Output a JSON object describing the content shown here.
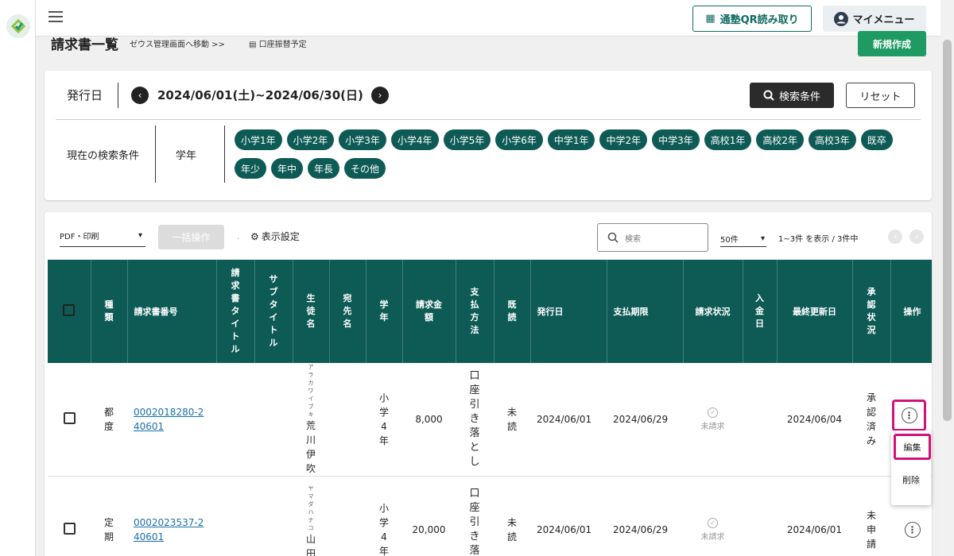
{
  "header": {
    "qr_label": "通塾QR読み取り",
    "mymenu_label": "マイメニュー"
  },
  "page": {
    "title": "請求書一覧",
    "zeus_link": "ゼウス管理画面へ移動 >>",
    "schedule_link": "口座振替予定",
    "new_button": "新規作成"
  },
  "filter": {
    "date_label": "発行日",
    "date_range": "2024/06/01(土)~2024/06/30(日)",
    "search_button": "検索条件",
    "reset_button": "リセット",
    "current_label": "現在の検索条件",
    "grade_label": "学年",
    "chips": [
      "小学1年",
      "小学2年",
      "小学3年",
      "小学4年",
      "小学5年",
      "小学6年",
      "中学1年",
      "中学2年",
      "中学3年",
      "高校1年",
      "高校2年",
      "高校3年",
      "既卒",
      "年少",
      "年中",
      "年長",
      "その他"
    ]
  },
  "toolbar": {
    "pdf_select": "PDF・印刷",
    "bulk_button": "一括操作",
    "display_settings": "表示設定",
    "search_placeholder": "検索",
    "page_size": "50件",
    "range_text": "1~3件 を表示 / 3件中"
  },
  "table": {
    "headers": {
      "type": "種類",
      "number": "請求書番号",
      "title": "請求書タイトル",
      "subtitle": "サブタイトル",
      "student": "生徒名",
      "addressee": "宛先名",
      "grade": "学年",
      "amount": "請求金額",
      "method": "支払方法",
      "read": "既読",
      "issued": "発行日",
      "due": "支払期限",
      "status": "請求状況",
      "paid": "入金日",
      "updated": "最終更新日",
      "approval": "承認状況",
      "ops": "操作"
    },
    "rows": [
      {
        "type": "都度",
        "number": "0002018280-240601",
        "student_kana": "アラカワイブキ",
        "student": "荒川伊吹",
        "grade": "小学4年",
        "amount": "8,000",
        "method": "口座引き落とし",
        "read": "未読",
        "issued": "2024/06/01",
        "due": "2024/06/29",
        "status": "未請求",
        "updated": "2024/06/04",
        "approval": "承認済み"
      },
      {
        "type": "定期",
        "number": "0002023537-240601",
        "student_kana": "ヤマダハナコ",
        "student": "山田花",
        "grade": "小学4年",
        "amount": "20,000",
        "method": "口座引き落と",
        "read": "未読",
        "issued": "2024/06/01",
        "due": "2024/06/29",
        "status": "未請求",
        "updated": "2024/06/01",
        "approval": "未申請"
      }
    ]
  },
  "row_menu": {
    "edit": "編集",
    "delete": "削除"
  }
}
